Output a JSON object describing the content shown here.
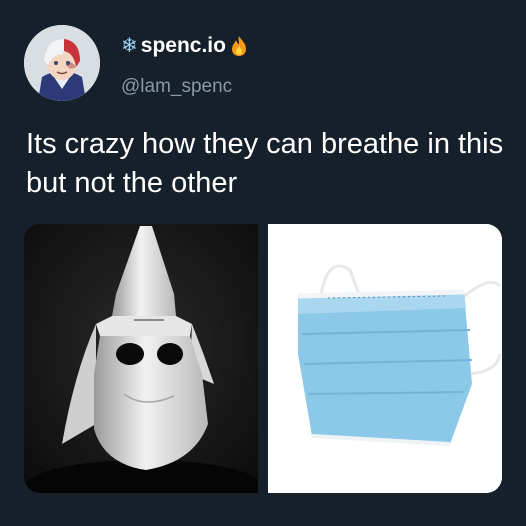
{
  "tweet": {
    "display_name": "spenc.io",
    "name_prefix_icon": "snowflake-icon",
    "name_suffix_icon": "fire-icon",
    "handle": "@lam_spenc",
    "text": "Its crazy how they can breathe in this but not the other"
  },
  "media": {
    "left_image": "white-hooded-mask-photo",
    "right_image": "surgical-face-mask-photo"
  },
  "colors": {
    "background": "#15202b",
    "handle_text": "#8899a6",
    "mask_blue": "#8cc8e8"
  }
}
